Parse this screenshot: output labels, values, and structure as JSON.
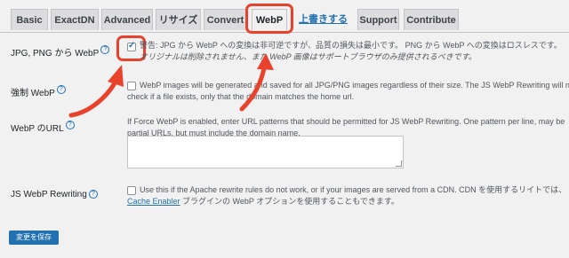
{
  "tabs": [
    {
      "label": "Basic"
    },
    {
      "label": "ExactDN"
    },
    {
      "label": "Advanced"
    },
    {
      "label": "リサイズ"
    },
    {
      "label": "Convert"
    },
    {
      "label": "WebP"
    },
    {
      "label": "上書きする"
    },
    {
      "label": "Support"
    },
    {
      "label": "Contribute"
    }
  ],
  "rows": {
    "jpg_webp": {
      "label": "JPG, PNG から WebP",
      "help": "?",
      "desc_1": "警告: JPG から WebP への変換は非可逆ですが、品質の損失は最小です。 PNG から WebP への変換はロスレスです。",
      "desc_2": "オリジナルは削除されません、また WebP 画像はサポートブラウザのみ提供されるべきです。"
    },
    "force_webp": {
      "label": "強制 WebP",
      "help": "?",
      "desc_1": "WebP images will be generated and saved for all JPG/PNG images regardless of their size. The JS WebP Rewriting will not",
      "desc_2": "check if a file exists, only that the domain matches the home url."
    },
    "webp_urls": {
      "label": "WebP のURL",
      "help": "?",
      "desc_1": "If Force WebP is enabled, enter URL patterns that should be permitted for JS WebP Rewriting. One pattern per line, may be",
      "desc_2": "partial URLs, but must include the domain name."
    },
    "js_rewriting": {
      "label": "JS WebP Rewriting",
      "help": "?",
      "desc_1": "Use this if the Apache rewrite rules do not work, or if your images are served from a CDN. CDN を使用するリイトでは、",
      "desc_2_link": "Cache Enabler",
      "desc_2_rest": " ブラグインの WebP オプションを使用することもできます。"
    }
  },
  "save_button": "変更を保存",
  "colors": {
    "accent": "#2271b1",
    "highlight": "#e8412c",
    "background": "#f1f1f1"
  }
}
